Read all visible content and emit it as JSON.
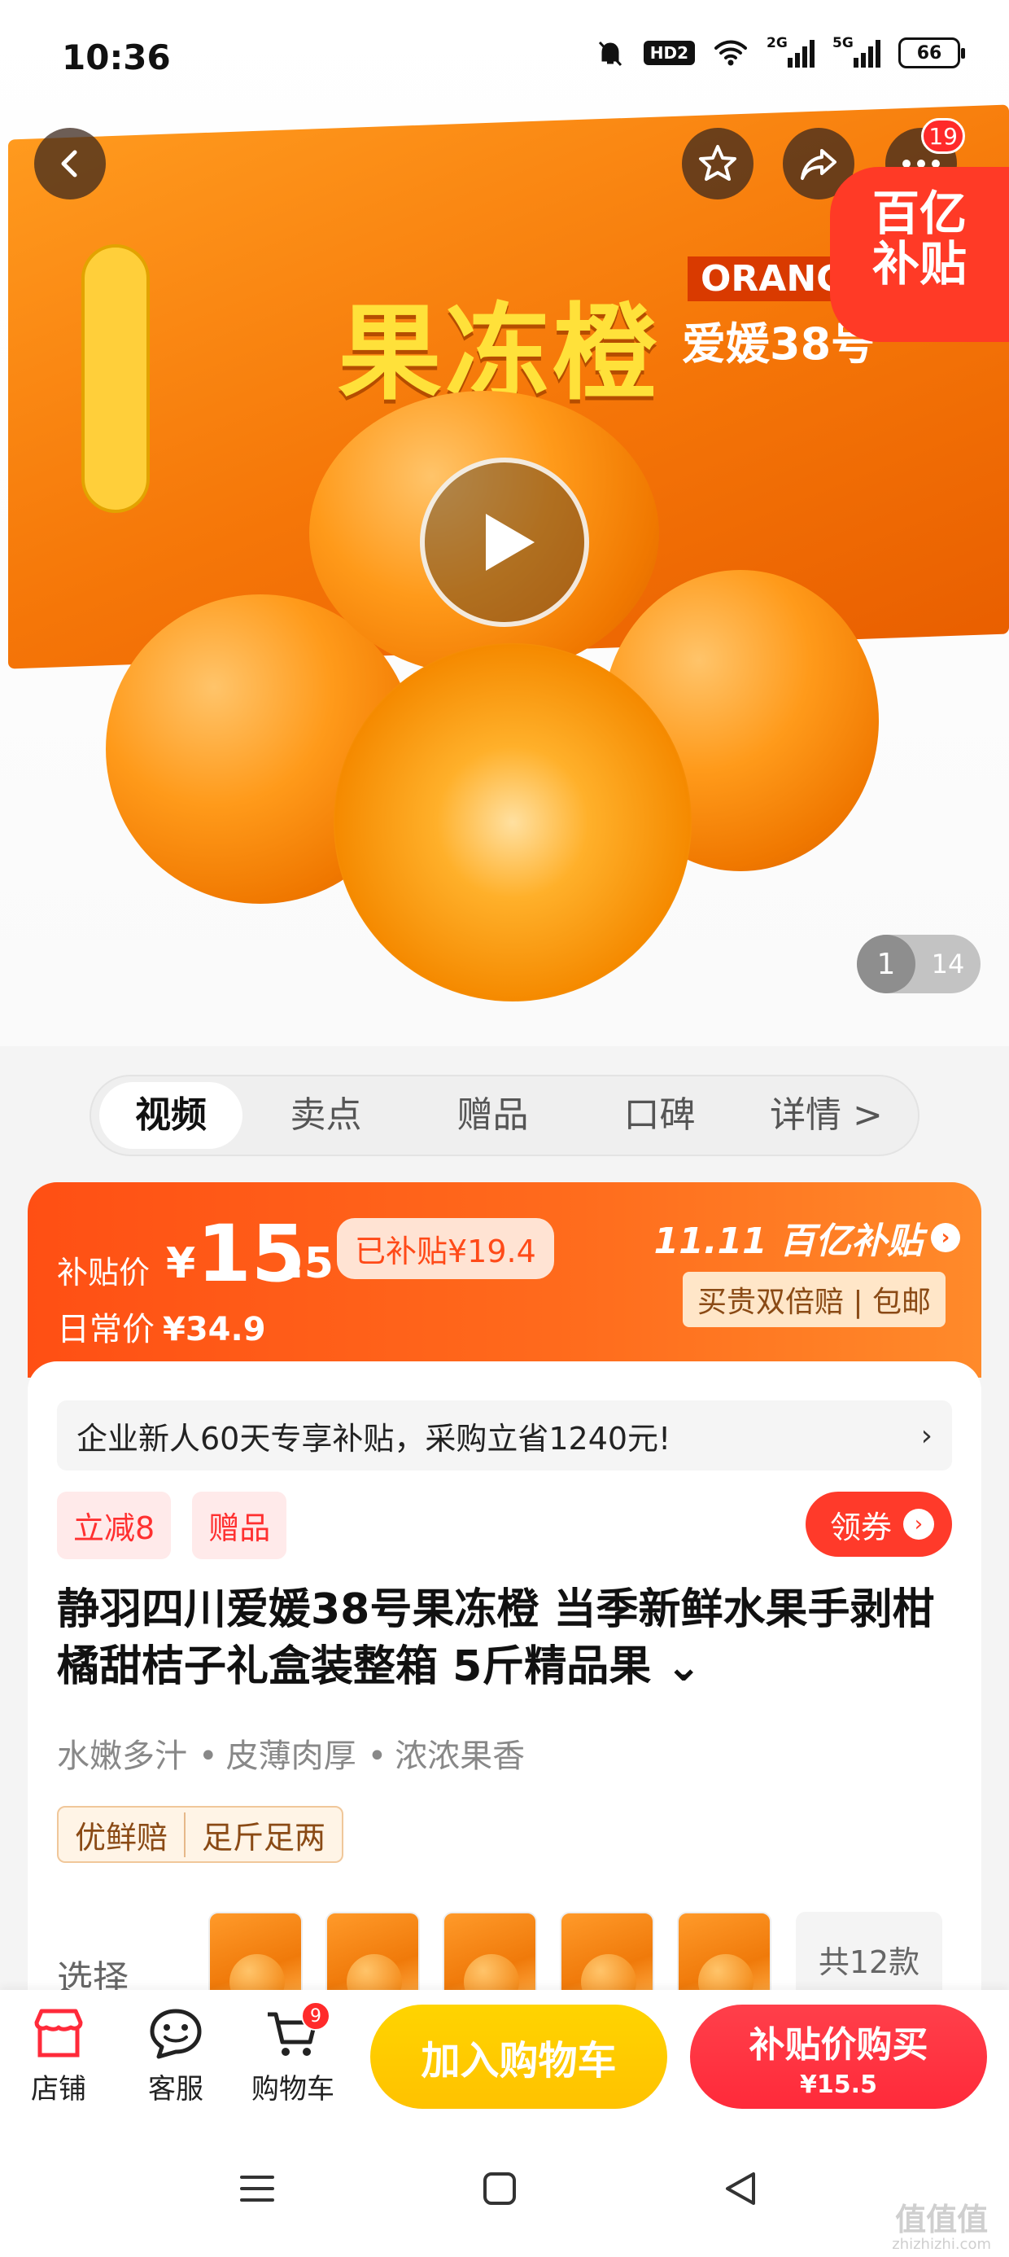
{
  "status_bar": {
    "time": "10:36",
    "hd": "HD2",
    "net1": "2G",
    "net2": "5G",
    "battery": "66"
  },
  "hero": {
    "box_title": "果冻橙",
    "box_en": "ORANGE",
    "box_variety": "爱媛38号",
    "more_badge": "19",
    "subsidy_line1": "百亿",
    "subsidy_line2": "补贴",
    "counter_current": "1",
    "counter_total": "14"
  },
  "tabs": [
    {
      "label": "视频"
    },
    {
      "label": "卖点"
    },
    {
      "label": "赠品"
    },
    {
      "label": "口碑"
    },
    {
      "label": "详情 >"
    }
  ],
  "price": {
    "label": "补贴价",
    "yen": "¥",
    "int": "15",
    "dec": ".5",
    "subsidized": "已补贴¥19.4",
    "daily_label": "日常价",
    "daily_value": "¥34.9",
    "brand": "11.11 百亿补贴",
    "guarantee": "买贵双倍赔 | 包邮"
  },
  "product": {
    "promo": "企业新人60天专享补贴，采购立省1240元!",
    "promo_arrow": "›",
    "tag1": "立减8",
    "tag2": "赠品",
    "coupon": "领券",
    "title": "静羽四川爱媛38号果冻橙 当季新鲜水果手剥柑橘甜桔子礼盒装整箱 5斤精品果 ⌄",
    "features": [
      "水嫩多汁",
      "皮薄肉厚",
      "浓浓果香"
    ],
    "badges": [
      "优鲜赔",
      "足斤足两"
    ],
    "select_label": "选择",
    "variant_total": "共12款"
  },
  "bottom_bar": {
    "shop": "店铺",
    "service": "客服",
    "cart": "购物车",
    "cart_badge": "9",
    "add_cart": "加入购物车",
    "buy_line1": "补贴价购买",
    "buy_line2": "¥15.5"
  },
  "watermark": {
    "main": "值值值",
    "sub": "zhizhizhi.com"
  },
  "colors": {
    "accent": "#ff4f14",
    "buy": "#ff2a3a",
    "cart": "#ffc800"
  }
}
